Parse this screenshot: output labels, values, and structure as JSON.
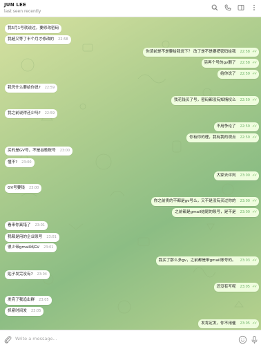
{
  "header": {
    "contact_name": "JUN LEE",
    "status": "last seen recently"
  },
  "composer": {
    "placeholder": "Write a message..."
  },
  "colors": {
    "incoming_bubble": "#ffffff",
    "outgoing_bubble": "#effdde",
    "read_ticks": "#5fae4e"
  },
  "messages": [
    {
      "side": "in",
      "text": "我5月1号就说过，要修改密码",
      "time": ""
    },
    {
      "side": "in",
      "text": "我超又等了半个月才修改的",
      "time": "22:58"
    },
    {
      "side": "out",
      "text": "你该前是不是要给我说下？ 改了是不是要把密码给我",
      "time": "22:58"
    },
    {
      "side": "out",
      "text": "另再个号的gv删了",
      "time": "22:58"
    },
    {
      "side": "out",
      "text": "给你说了",
      "time": "22:59"
    },
    {
      "side": "in",
      "text": "我凭什么要给你说?",
      "time": "22:59"
    },
    {
      "side": "out",
      "text": "我花钱买了号，密码都没有知情权么",
      "time": "22:59"
    },
    {
      "side": "in",
      "text": "我之前说得还少吗?",
      "time": "22:59"
    },
    {
      "side": "out",
      "text": "不用争论了",
      "time": "22:59"
    },
    {
      "side": "out",
      "text": "你有你的理，我有我的观点",
      "time": "22:59"
    },
    {
      "side": "in",
      "text": "买的是GV号，不是谷歌账号",
      "time": "23:00"
    },
    {
      "side": "in",
      "text": "懂不?",
      "time": "23:00"
    },
    {
      "side": "out",
      "text": "大家去评判",
      "time": "23:00"
    },
    {
      "side": "in",
      "text": "GV号要钱",
      "time": "23:00"
    },
    {
      "side": "out",
      "text": "你之前卖的不都是gv号么，又不是没有买过你的",
      "time": "23:00"
    },
    {
      "side": "out",
      "text": "之前都是gmail结尾的账号，是不是",
      "time": "23:00"
    },
    {
      "side": "in",
      "text": "看来你真错了",
      "time": "23:01"
    },
    {
      "side": "in",
      "text": "我都是用的企业账号",
      "time": "23:01"
    },
    {
      "side": "in",
      "text": "很少带gmail出GV",
      "time": "23:01"
    },
    {
      "side": "out",
      "text": "我买了那么多gv，之前都是带gmail账号的。",
      "time": "23:03"
    },
    {
      "side": "in",
      "text": "贴子发完没有?",
      "time": "23:04"
    },
    {
      "side": "out",
      "text": "还没有写呢",
      "time": "23:05"
    },
    {
      "side": "in",
      "text": "发完了我追出群",
      "time": "23:05"
    },
    {
      "side": "in",
      "text": "抓紧时间发",
      "time": "23:05"
    },
    {
      "side": "out",
      "text": "发肯定发，你不用催",
      "time": "23:05"
    }
  ]
}
